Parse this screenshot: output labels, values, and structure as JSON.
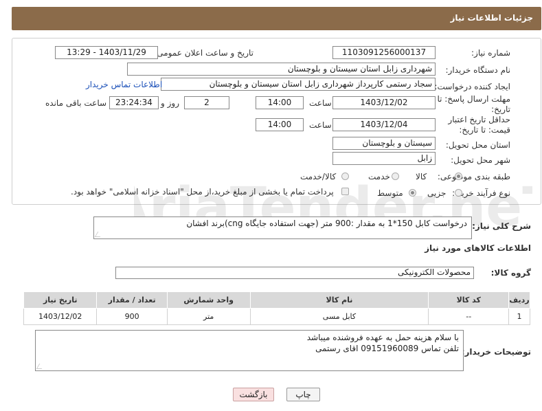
{
  "header": {
    "title": "جزئیات اطلاعات نیاز"
  },
  "form": {
    "need_number_label": "شماره نیاز:",
    "need_number": "1103091256000137",
    "announce_label": "تاریخ و ساعت اعلان عمومی:",
    "announce_value": "1403/11/29 - 13:29",
    "buyer_org_label": "نام دستگاه خریدار:",
    "buyer_org": "شهرداری زابل استان سیستان و بلوچستان",
    "creator_label": "ایجاد کننده درخواست:",
    "creator": "سجاد رستمی کارپرداز شهرداری زابل استان سیستان و بلوچستان",
    "contact_link": "اطلاعات تماس خریدار",
    "deadline_label": "مهلت ارسال پاسخ: تا تاریخ:",
    "deadline_date": "1403/12/02",
    "time_label": "ساعت",
    "deadline_time": "14:00",
    "days_value": "2",
    "days_and": "روز و",
    "remaining_time": "23:24:34",
    "remaining_label": "ساعت باقی مانده",
    "validity_label": "حداقل تاریخ اعتبار قیمت: تا تاریخ:",
    "validity_date": "1403/12/04",
    "validity_time": "14:00",
    "province_label": "استان محل تحویل:",
    "province": "سیستان و بلوچستان",
    "city_label": "شهر محل تحویل:",
    "city": "زابل",
    "category_label": "طبقه بندی موضوعی:",
    "category_options": [
      "کالا",
      "خدمت",
      "کالا/خدمت"
    ],
    "purchase_type_label": "نوع فرآیند خرید :",
    "purchase_options": [
      "جزیی",
      "متوسط"
    ],
    "treasury_note": "پرداخت تمام یا بخشی از مبلغ خرید،از محل \"اسناد خزانه اسلامی\" خواهد بود."
  },
  "description": {
    "label": "شرح کلی نیاز:",
    "text": "درخواست کابل 150*1  به مقدار :900 متر (جهت استفاده جایگاه cng)برند افشان"
  },
  "goods_section": {
    "title": "اطلاعات کالاهای مورد نیاز",
    "group_label": "گروه کالا:",
    "group_value": "محصولات الکترونیکی"
  },
  "table": {
    "headers": [
      "ردیف",
      "کد کالا",
      "نام کالا",
      "واحد شمارش",
      "تعداد / مقدار",
      "تاریخ نیاز"
    ],
    "rows": [
      [
        "1",
        "--",
        "کابل مسی",
        "متر",
        "900",
        "1403/12/02"
      ]
    ]
  },
  "buyer_notes": {
    "label": "توضیحات خریدار:",
    "line1": "با سلام هزینه حمل به عهده فروشنده  میباشد",
    "line2": "تلفن تماس 09151960089 اقای رستمی"
  },
  "buttons": {
    "print": "چاپ",
    "back": "بازگشت"
  },
  "watermark": {
    "text": "AriaTender.neT"
  }
}
